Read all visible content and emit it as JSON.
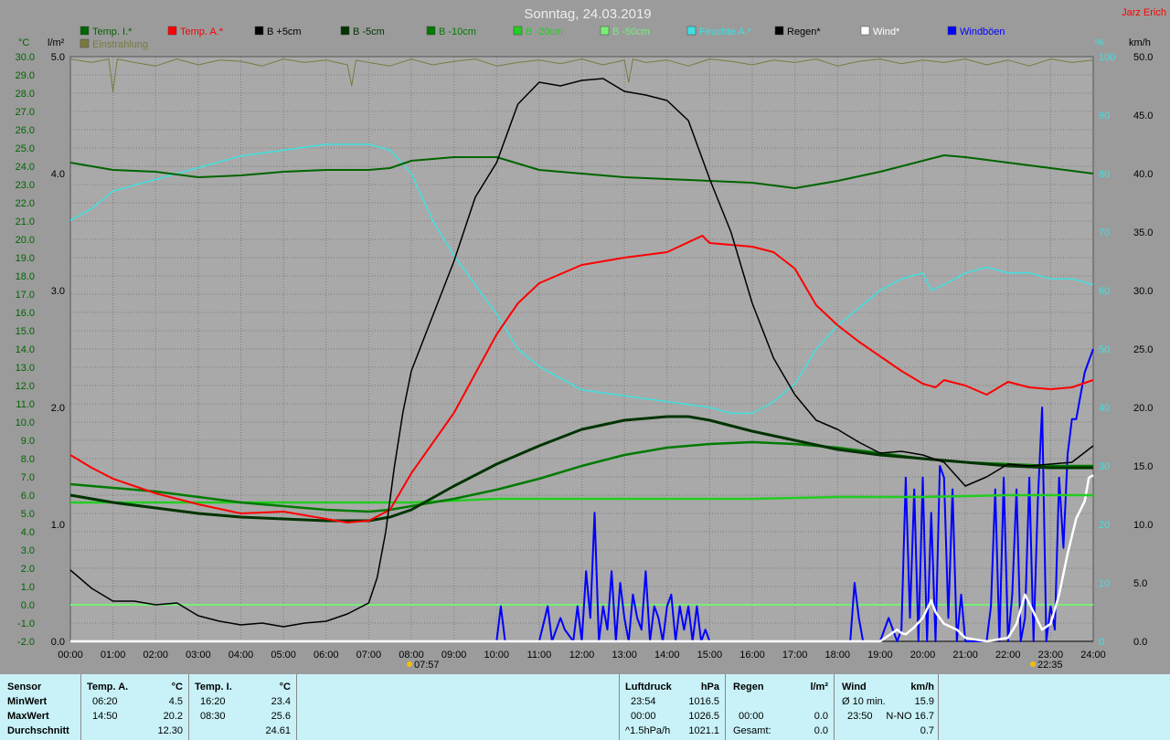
{
  "header": {
    "title": "Sonntag, 24.03.2019",
    "author": "Jarz Erich",
    "left_unit_1": "°C",
    "left_unit_2": "l/m²",
    "right_unit_1": "%",
    "right_unit_2": "km/h"
  },
  "legend": [
    {
      "label": "Temp. I.*",
      "color": "#006400"
    },
    {
      "label": "Temp. A.*",
      "color": "#ff0000"
    },
    {
      "label": "B +5cm",
      "color": "#000000"
    },
    {
      "label": "B -5cm",
      "color": "#003300"
    },
    {
      "label": "B -10cm",
      "color": "#007a00"
    },
    {
      "label": "B -20cm",
      "color": "#22cc22"
    },
    {
      "label": "B -50cm",
      "color": "#77ee77"
    },
    {
      "label": "Feuchte A.*",
      "color": "#40e0e0"
    },
    {
      "label": "Regen*",
      "color": "#000000"
    },
    {
      "label": "Wind*",
      "color": "#ffffff"
    },
    {
      "label": "Windböen",
      "color": "#0000ff"
    },
    {
      "label": "Einstrahlung",
      "color": "#7a7a40"
    }
  ],
  "markers": {
    "sunrise": "07:57",
    "sunset": "22:35"
  },
  "chart_data": {
    "type": "line",
    "x_unit": "hours",
    "x_ticks": [
      "00:00",
      "01:00",
      "02:00",
      "03:00",
      "04:00",
      "05:00",
      "06:00",
      "07:00",
      "08:00",
      "09:00",
      "10:00",
      "11:00",
      "12:00",
      "13:00",
      "14:00",
      "15:00",
      "16:00",
      "17:00",
      "18:00",
      "19:00",
      "20:00",
      "21:00",
      "22:00",
      "23:00",
      "24:00"
    ],
    "xlim": [
      0,
      24
    ],
    "temp_axis": {
      "ylim": [
        -2,
        30
      ],
      "ticks": [
        "30.0",
        "29.0",
        "28.0",
        "27.0",
        "26.0",
        "25.0",
        "24.0",
        "23.0",
        "22.0",
        "21.0",
        "20.0",
        "19.0",
        "18.0",
        "17.0",
        "16.0",
        "15.0",
        "14.0",
        "13.0",
        "12.0",
        "11.0",
        "10.0",
        "9.0",
        "8.0",
        "7.0",
        "6.0",
        "5.0",
        "4.0",
        "3.0",
        "2.0",
        "1.0",
        "0.0",
        "-1.0",
        "-2.0"
      ]
    },
    "rain_axis": {
      "ylim": [
        0,
        5
      ],
      "ticks": [
        "5.0",
        "4.0",
        "3.0",
        "2.0",
        "1.0",
        "0.0"
      ]
    },
    "humidity_axis": {
      "ylim": [
        0,
        100
      ],
      "ticks": [
        "100",
        "90",
        "80",
        "70",
        "60",
        "50",
        "40",
        "30",
        "20",
        "10",
        "0"
      ]
    },
    "wind_axis": {
      "ylim": [
        0,
        50
      ],
      "ticks": [
        "50.0",
        "45.0",
        "40.0",
        "35.0",
        "30.0",
        "25.0",
        "20.0",
        "15.0",
        "10.0",
        "5.0",
        "0.0"
      ]
    },
    "series": [
      {
        "name": "Temp. I.*",
        "axis": "temp",
        "color": "#006400",
        "width": 2,
        "x": [
          0,
          1,
          2,
          3,
          4,
          5,
          6,
          7,
          7.5,
          8,
          9,
          10,
          11,
          12,
          13,
          14,
          15,
          16,
          17,
          18,
          19,
          20,
          20.5,
          21,
          22,
          23,
          24
        ],
        "y": [
          24.2,
          23.8,
          23.7,
          23.4,
          23.5,
          23.7,
          23.8,
          23.8,
          23.9,
          24.3,
          24.5,
          24.5,
          23.8,
          23.6,
          23.4,
          23.3,
          23.2,
          23.1,
          22.8,
          23.2,
          23.7,
          24.3,
          24.6,
          24.5,
          24.2,
          23.9,
          23.6
        ]
      },
      {
        "name": "Temp. A.*",
        "axis": "temp",
        "color": "#ff0000",
        "width": 2,
        "x": [
          0,
          0.5,
          1,
          1.5,
          2,
          3,
          4,
          5,
          5.5,
          6,
          6.5,
          7,
          7.5,
          8,
          9,
          10,
          10.5,
          11,
          12,
          13,
          14,
          14.83,
          15,
          16,
          16.5,
          17,
          17.5,
          18,
          18.5,
          19,
          19.5,
          20,
          20.3,
          20.5,
          21,
          21.5,
          22,
          22.5,
          23,
          23.5,
          24
        ],
        "y": [
          8.2,
          7.5,
          6.9,
          6.5,
          6.1,
          5.5,
          5.0,
          5.1,
          4.9,
          4.7,
          4.5,
          4.6,
          5.2,
          7.2,
          10.5,
          14.8,
          16.5,
          17.6,
          18.6,
          19.0,
          19.3,
          20.2,
          19.8,
          19.6,
          19.3,
          18.4,
          16.4,
          15.3,
          14.4,
          13.6,
          12.8,
          12.1,
          11.9,
          12.3,
          12.0,
          11.5,
          12.2,
          11.9,
          11.8,
          11.9,
          12.3
        ]
      },
      {
        "name": "B +5cm",
        "axis": "temp",
        "color": "#000000",
        "width": 1.5,
        "x": [
          0,
          0.5,
          1,
          1.5,
          2,
          2.5,
          3,
          3.5,
          4,
          4.5,
          5,
          5.5,
          6,
          6.5,
          7,
          7.2,
          7.4,
          7.6,
          7.8,
          8,
          8.5,
          9,
          9.5,
          10,
          10.5,
          11,
          11.5,
          12,
          12.5,
          13,
          13.5,
          14,
          14.5,
          15,
          15.5,
          16,
          16.5,
          17,
          17.5,
          18,
          18.5,
          19,
          19.5,
          20,
          20.5,
          21,
          21.5,
          22,
          22.5,
          23,
          23.5,
          24
        ],
        "y": [
          1.9,
          0.9,
          0.2,
          0.2,
          0.0,
          0.1,
          -0.6,
          -0.9,
          -1.1,
          -1.0,
          -1.2,
          -1.0,
          -0.9,
          -0.5,
          0.1,
          1.5,
          4.0,
          7.5,
          10.5,
          12.8,
          15.8,
          18.8,
          22.3,
          24.2,
          27.4,
          28.6,
          28.4,
          28.7,
          28.8,
          28.1,
          27.9,
          27.6,
          26.5,
          23.3,
          20.4,
          16.5,
          13.5,
          11.5,
          10.1,
          9.6,
          8.9,
          8.3,
          8.4,
          8.2,
          7.8,
          6.5,
          7.0,
          7.7,
          7.6,
          7.7,
          7.8,
          8.7
        ]
      },
      {
        "name": "B -5cm",
        "axis": "temp",
        "color": "#003300",
        "width": 3,
        "x": [
          0,
          1,
          2,
          3,
          4,
          5,
          6,
          7,
          7.5,
          8,
          9,
          10,
          11,
          12,
          13,
          14,
          14.5,
          15,
          16,
          17,
          18,
          19,
          20,
          21,
          22,
          23,
          24
        ],
        "y": [
          6.0,
          5.6,
          5.3,
          5.0,
          4.8,
          4.7,
          4.6,
          4.6,
          4.8,
          5.2,
          6.5,
          7.7,
          8.7,
          9.6,
          10.1,
          10.3,
          10.3,
          10.1,
          9.5,
          9.0,
          8.5,
          8.2,
          8.0,
          7.8,
          7.6,
          7.5,
          7.5
        ]
      },
      {
        "name": "B -10cm",
        "axis": "temp",
        "color": "#007a00",
        "width": 2.5,
        "x": [
          0,
          1,
          2,
          3,
          4,
          5,
          6,
          7,
          7.5,
          8,
          9,
          10,
          11,
          12,
          13,
          14,
          15,
          16,
          17,
          18,
          19,
          20,
          21,
          22,
          23,
          24
        ],
        "y": [
          6.6,
          6.4,
          6.2,
          5.9,
          5.6,
          5.4,
          5.2,
          5.1,
          5.2,
          5.4,
          5.8,
          6.3,
          6.9,
          7.6,
          8.2,
          8.6,
          8.8,
          8.9,
          8.8,
          8.6,
          8.3,
          8.0,
          7.8,
          7.7,
          7.6,
          7.6
        ]
      },
      {
        "name": "B -20cm",
        "axis": "temp",
        "color": "#22cc22",
        "width": 2.5,
        "x": [
          0,
          2,
          4,
          6,
          8,
          10,
          12,
          14,
          16,
          18,
          20,
          22,
          24
        ],
        "y": [
          5.6,
          5.6,
          5.6,
          5.6,
          5.6,
          5.8,
          5.8,
          5.8,
          5.8,
          5.9,
          5.9,
          6.0,
          6.0
        ]
      },
      {
        "name": "B -50cm",
        "axis": "temp",
        "color": "#77ee77",
        "width": 2,
        "x": [
          0,
          24
        ],
        "y": [
          0.0,
          0.0
        ]
      },
      {
        "name": "Feuchte A.*",
        "axis": "humidity",
        "color": "#40e0e0",
        "width": 1.5,
        "x": [
          0,
          0.5,
          1,
          2,
          3,
          4,
          5,
          6,
          7,
          7.5,
          8,
          8.5,
          9,
          9.5,
          10,
          10.5,
          11,
          12,
          13,
          14,
          15,
          15.5,
          16,
          16.5,
          17,
          17.5,
          18,
          18.5,
          19,
          19.5,
          20,
          20.2,
          20.5,
          21,
          21.5,
          22,
          22.5,
          23,
          23.5,
          24
        ],
        "y": [
          72,
          74,
          77,
          79,
          81,
          83,
          84,
          85,
          85,
          84,
          80,
          72,
          66,
          61,
          56,
          50,
          47,
          43,
          42,
          41,
          40,
          39,
          39,
          41,
          44,
          50,
          54,
          57,
          60,
          62,
          63,
          60,
          61,
          63,
          64,
          63,
          63,
          62,
          62,
          61
        ]
      },
      {
        "name": "Windböen",
        "axis": "wind",
        "color": "#0000ff",
        "width": 2,
        "x": [
          0,
          10,
          10.1,
          10.2,
          11,
          11.2,
          11.3,
          11.5,
          11.6,
          11.8,
          11.9,
          12,
          12.1,
          12.2,
          12.3,
          12.4,
          12.5,
          12.6,
          12.7,
          12.8,
          12.9,
          13,
          13.1,
          13.2,
          13.3,
          13.4,
          13.5,
          13.6,
          13.7,
          13.8,
          13.9,
          14,
          14.1,
          14.2,
          14.3,
          14.4,
          14.5,
          14.6,
          14.7,
          14.8,
          14.9,
          15,
          18.3,
          18.4,
          18.5,
          18.6,
          19,
          19.2,
          19.4,
          19.5,
          19.6,
          19.7,
          19.8,
          19.9,
          20,
          20.1,
          20.2,
          20.3,
          20.4,
          20.5,
          20.6,
          20.7,
          20.8,
          20.9,
          21,
          21.5,
          21.6,
          21.7,
          21.8,
          21.9,
          22,
          22.1,
          22.2,
          22.3,
          22.4,
          22.5,
          22.6,
          22.7,
          22.8,
          22.9,
          23,
          23.1,
          23.2,
          23.3,
          23.4,
          23.5,
          23.6,
          23.7,
          23.8,
          23.9,
          24
        ],
        "y": [
          0,
          0,
          3,
          0,
          0,
          3,
          0,
          2,
          1,
          0,
          3,
          0,
          6,
          2,
          11,
          0,
          3,
          1,
          6,
          0,
          5,
          2,
          0,
          4,
          2,
          1,
          6,
          0,
          3,
          2,
          0,
          3,
          4,
          0,
          3,
          1,
          3,
          0,
          3,
          0,
          1,
          0,
          0,
          5,
          2,
          0,
          0,
          2,
          0,
          1,
          14,
          2,
          13,
          0,
          14,
          0,
          11,
          0,
          15,
          14,
          2,
          13,
          0,
          4,
          0,
          0,
          3,
          13,
          0,
          14,
          0,
          4,
          13,
          0,
          2,
          14,
          0,
          12,
          20,
          0,
          3,
          1,
          14,
          8,
          16,
          19,
          19,
          21,
          23,
          24,
          25
        ]
      },
      {
        "name": "Wind*",
        "axis": "wind",
        "color": "#ffffff",
        "width": 2.5,
        "x": [
          0,
          19,
          19.2,
          19.4,
          19.5,
          19.6,
          19.8,
          20,
          20.2,
          20.3,
          20.5,
          20.8,
          21,
          21.5,
          22,
          22.2,
          22.4,
          22.6,
          22.8,
          23,
          23.2,
          23.4,
          23.6,
          23.8,
          23.9,
          24
        ],
        "y": [
          0,
          0,
          0.5,
          1,
          0.7,
          0.6,
          1.2,
          2.0,
          3.5,
          2.5,
          1.5,
          1.0,
          0.3,
          0,
          0.3,
          1.5,
          4.0,
          2.5,
          1.0,
          1.5,
          4.0,
          7.5,
          10.5,
          12,
          14,
          14.2
        ]
      },
      {
        "name": "Regen*",
        "axis": "rain",
        "color": "#000000",
        "width": 1,
        "x": [
          0,
          24
        ],
        "y": [
          0,
          0
        ]
      },
      {
        "name": "Einstrahlung",
        "axis": "rain",
        "color": "#7a7a40",
        "width": 1,
        "x": [
          0,
          0.5,
          0.9,
          1.0,
          1.1,
          1.5,
          2,
          2.5,
          3,
          3.5,
          4,
          4.5,
          5,
          5.5,
          6,
          6.5,
          6.6,
          6.7,
          7,
          7.5,
          8,
          8.5,
          9,
          9.5,
          10,
          10.5,
          11,
          11.5,
          12,
          12.5,
          13,
          13.1,
          13.2,
          13.5,
          14,
          14.5,
          15,
          15.5,
          16,
          16.5,
          17,
          17.5,
          18,
          18.5,
          19,
          19.5,
          20,
          20.5,
          21,
          21.5,
          22,
          22.5,
          23,
          23.5,
          24
        ],
        "y": [
          4.98,
          4.95,
          4.98,
          4.7,
          4.98,
          4.95,
          4.92,
          4.98,
          4.93,
          4.97,
          4.96,
          4.92,
          4.98,
          4.95,
          4.97,
          4.93,
          4.75,
          4.97,
          4.95,
          4.92,
          4.98,
          4.93,
          4.96,
          4.98,
          4.92,
          4.95,
          4.97,
          4.94,
          4.98,
          4.93,
          4.97,
          4.78,
          4.98,
          4.95,
          4.97,
          4.92,
          4.98,
          4.96,
          4.93,
          4.97,
          4.95,
          4.98,
          4.92,
          4.96,
          4.98,
          4.94,
          4.97,
          4.95,
          4.98,
          4.93,
          4.97,
          4.92,
          4.98,
          4.95,
          4.97
        ]
      }
    ]
  },
  "table": {
    "sensor_label": "Sensor",
    "min_label": "MinWert",
    "max_label": "MaxWert",
    "avg_label": "Durchschnitt",
    "temp_a": {
      "header": "Temp. A.",
      "unit": "°C",
      "min_time": "06:20",
      "min_val": "4.5",
      "max_time": "14:50",
      "max_val": "20.2",
      "avg": "12.30"
    },
    "temp_i": {
      "header": "Temp. I.",
      "unit": "°C",
      "min_time": "16:20",
      "min_val": "23.4",
      "max_time": "08:30",
      "max_val": "25.6",
      "avg": "24.61"
    },
    "pressure": {
      "header": "Luftdruck",
      "unit": "hPa",
      "r1_time": "23:54",
      "r1_val": "1016.5",
      "r2_time": "00:00",
      "r2_val": "1026.5",
      "r3_time": "^1.5hPa/h",
      "r3_val": "1021.1"
    },
    "rain": {
      "header": "Regen",
      "unit": "l/m²",
      "r2_time": "00:00",
      "r2_val": "0.0",
      "r3_label": "Gesamt:",
      "r3_val": "0.0"
    },
    "wind": {
      "header": "Wind",
      "unit": "km/h",
      "r1_label": "Ø 10 min.",
      "r1_val": "15.9",
      "r2_time": "23:50",
      "r2_val": "N-NO 16.7",
      "r3_val": "0.7"
    }
  }
}
